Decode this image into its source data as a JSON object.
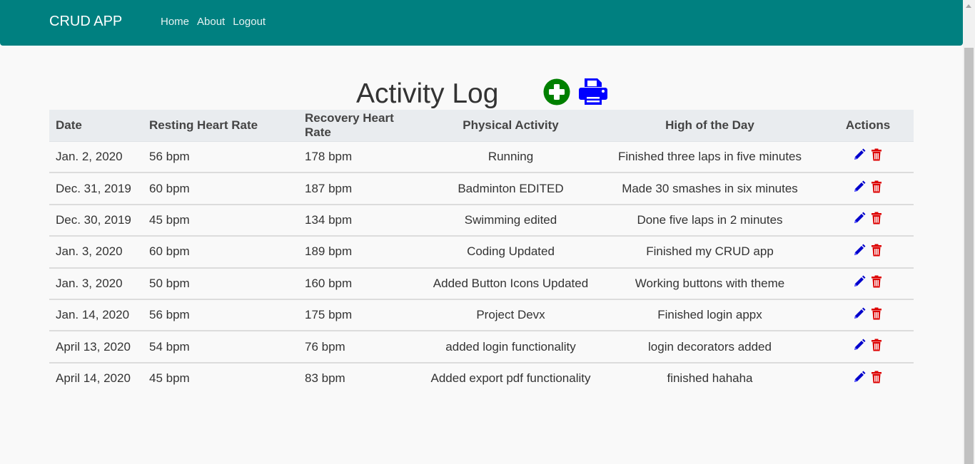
{
  "navbar": {
    "brand": "CRUD APP",
    "links": [
      "Home",
      "About",
      "Logout"
    ]
  },
  "page": {
    "title": "Activity Log",
    "add_icon": "plus-circle-icon",
    "print_icon": "printer-icon"
  },
  "table": {
    "headers": [
      "Date",
      "Resting Heart Rate",
      "Recovery Heart Rate",
      "Physical Activity",
      "High of the Day",
      "Actions"
    ],
    "rows": [
      {
        "date": "Jan. 2, 2020",
        "resting": "56 bpm",
        "recovery": "178 bpm",
        "activity": "Running",
        "high": "Finished three laps in five minutes"
      },
      {
        "date": "Dec. 31, 2019",
        "resting": "60 bpm",
        "recovery": "187 bpm",
        "activity": "Badminton EDITED",
        "high": "Made 30 smashes in six minutes"
      },
      {
        "date": "Dec. 30, 2019",
        "resting": "45 bpm",
        "recovery": "134 bpm",
        "activity": "Swimming edited",
        "high": "Done five laps in 2 minutes"
      },
      {
        "date": "Jan. 3, 2020",
        "resting": "60 bpm",
        "recovery": "189 bpm",
        "activity": "Coding Updated",
        "high": "Finished my CRUD app"
      },
      {
        "date": "Jan. 3, 2020",
        "resting": "50 bpm",
        "recovery": "160 bpm",
        "activity": "Added Button Icons Updated",
        "high": "Working buttons with theme"
      },
      {
        "date": "Jan. 14, 2020",
        "resting": "56 bpm",
        "recovery": "175 bpm",
        "activity": "Project Devx",
        "high": "Finished login appx"
      },
      {
        "date": "April 13, 2020",
        "resting": "54 bpm",
        "recovery": "76 bpm",
        "activity": "added login functionality",
        "high": "login decorators added"
      },
      {
        "date": "April 14, 2020",
        "resting": "45 bpm",
        "recovery": "83 bpm",
        "activity": "Added export pdf functionality",
        "high": "finished hahaha"
      }
    ],
    "action_icons": [
      "pencil-icon",
      "trash-icon"
    ]
  },
  "colors": {
    "navbar": "#008080",
    "add_icon": "#008000",
    "print_icon": "#0000ff",
    "edit_icon": "#0000cc",
    "delete_icon": "#dd0000"
  }
}
